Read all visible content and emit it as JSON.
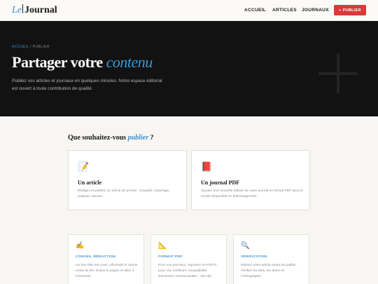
{
  "header": {
    "logo": {
      "le": "Le",
      "name": "Journal"
    },
    "nav": [
      "ACCUEIL",
      "ARTICLES",
      "JOURNAUX"
    ],
    "publish_button": {
      "icon": "+",
      "label": "PUBLIER"
    }
  },
  "hero": {
    "breadcrumb": {
      "home": "ACCUEIL",
      "separator": "/",
      "current": "PUBLIER"
    },
    "title": {
      "main": "Partager votre",
      "emphasis": "contenu"
    },
    "subtitle": "Publiez vos articles et journaux en quelques minutes. Notre espace éditorial est ouvert à toute contribution de qualité."
  },
  "section": {
    "title": {
      "before": "Que souhaitez-vous",
      "emphasis": "publier",
      "after": " ?"
    },
    "cards": [
      {
        "icon": "📝",
        "icon_name": "memo-icon",
        "title": "Un article",
        "desc": "Rédigez et publiez un article de presse : actualité, reportage, analyse, opinion…"
      },
      {
        "icon": "📕",
        "icon_name": "red-book-icon",
        "title": "Un journal PDF",
        "desc": "Ajoutez une nouvelle édition de votre journal en format PDF pour le rendre disponible en téléchargement."
      }
    ],
    "info": [
      {
        "icon": "✍️",
        "icon_name": "writing-hand-icon",
        "label": "CONSEIL RÉDACTION",
        "desc": "Un bon titre est court, informatif et donne envie de lire. Évitez le jargon et allez à l'essentiel."
      },
      {
        "icon": "📐",
        "icon_name": "triangular-ruler-icon",
        "label": "FORMAT PDF",
        "desc": "Pour vos journaux, exportez en PDF/A pour une meilleure compatibilité. Résolution recommandée : 150 dpi."
      },
      {
        "icon": "🔍",
        "icon_name": "magnifier-icon",
        "label": "VÉRIFICATION",
        "desc": "Relisez votre article avant de publier. Vérifiez les faits, les dates et l'orthographe."
      }
    ]
  },
  "colors": {
    "accent": "#3a8fd0",
    "publish": "#d83a3a",
    "hero_bg": "#121212",
    "page_bg": "#f7f6f3"
  }
}
